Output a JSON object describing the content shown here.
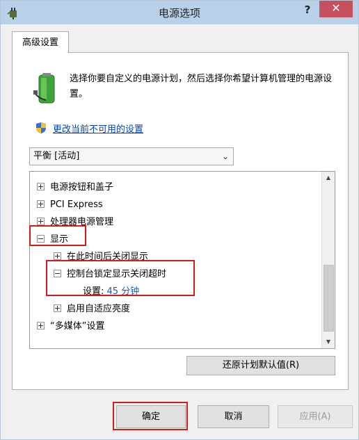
{
  "window": {
    "title": "电源选项",
    "help_label": "?",
    "close_label": "✕"
  },
  "tab": {
    "label": "高级设置"
  },
  "panel": {
    "description": "选择你要自定义的电源计划，然后选择你希望计算机管理的电源设置。",
    "change_link": "更改当前不可用的设置",
    "plan_select": {
      "value": "平衡 [活动]"
    }
  },
  "tree": {
    "items": [
      {
        "label": "电源按钮和盖子",
        "expander": "plus"
      },
      {
        "label": "PCI Express",
        "expander": "plus"
      },
      {
        "label": "处理器电源管理",
        "expander": "plus"
      },
      {
        "label": "显示",
        "expander": "minus"
      },
      {
        "label": "在此时间后关闭显示",
        "expander": "plus"
      },
      {
        "label": "控制台锁定显示关闭超时",
        "expander": "minus"
      },
      {
        "label": "设置:",
        "value": "45 分钟"
      },
      {
        "label": "启用自适应亮度",
        "expander": "plus"
      },
      {
        "label": "“多媒体”设置",
        "expander": "plus"
      }
    ]
  },
  "buttons": {
    "restore": "还原计划默认值(R)",
    "ok": "确定",
    "cancel": "取消",
    "apply": "应用(A)"
  },
  "colors": {
    "highlight": "#d71a1a",
    "link": "#0645ad",
    "titlebar": "#b9d0ea",
    "close": "#c7505d"
  }
}
